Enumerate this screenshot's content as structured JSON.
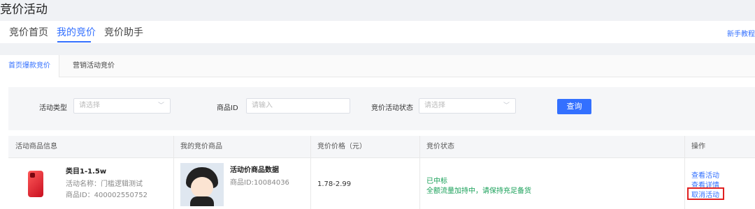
{
  "page_title": "竞价活动",
  "top_nav": {
    "tabs": [
      "竞价首页",
      "我的竞价",
      "竞价助手"
    ],
    "active_tab": "我的竞价",
    "help_link": "新手教程"
  },
  "sub_tabs": {
    "tabs": [
      "首页爆款竞价",
      "营销活动竞价"
    ],
    "active_tab": "首页爆款竞价"
  },
  "filters": {
    "activity_type_label": "活动类型",
    "activity_type_placeholder": "请选择",
    "product_id_label": "商品ID",
    "product_id_placeholder": "请输入",
    "status_label": "竞价活动状态",
    "status_placeholder": "请选择",
    "query_button": "查询"
  },
  "table": {
    "columns": [
      "活动商品信息",
      "我的竞价商品",
      "竞价价格（元）",
      "竞价状态",
      "操作"
    ],
    "rows": [
      {
        "product_name": "类目1-1.5w",
        "activity_name": "活动名称：门槛逻辑测试",
        "product_id": "商品ID：400002550752",
        "bid_product_name": "活动价商品数据",
        "bid_product_id": "商品ID:10084036",
        "price": "1.78-2.99",
        "status_main": "已中标",
        "status_detail": "全额流量加持中，请保持充足备货",
        "actions": [
          "查看活动",
          "查看详情",
          "取消活动"
        ]
      }
    ]
  },
  "colors": {
    "accent": "#3370ff",
    "success": "#18a058",
    "highlight_border": "#e02020"
  }
}
